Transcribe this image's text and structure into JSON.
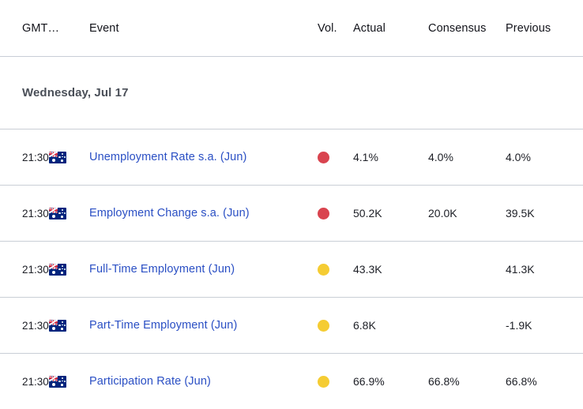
{
  "table": {
    "columns": {
      "time": "GMT…",
      "event": "Event",
      "volatility": "Vol.",
      "actual": "Actual",
      "consensus": "Consensus",
      "previous": "Previous"
    },
    "date_group": "Wednesday, Jul 17",
    "rows": [
      {
        "time": "21:30",
        "flag": "australia-flag-icon",
        "event": "Unemployment Rate s.a. (Jun)",
        "volatility": "high",
        "volatility_color": "#d9444f",
        "actual": "4.1%",
        "consensus": "4.0%",
        "previous": "4.0%"
      },
      {
        "time": "21:30",
        "flag": "australia-flag-icon",
        "event": "Employment Change s.a. (Jun)",
        "volatility": "high",
        "volatility_color": "#d9444f",
        "actual": "50.2K",
        "consensus": "20.0K",
        "previous": "39.5K"
      },
      {
        "time": "21:30",
        "flag": "australia-flag-icon",
        "event": "Full-Time Employment (Jun)",
        "volatility": "medium",
        "volatility_color": "#f5cc33",
        "actual": "43.3K",
        "consensus": "",
        "previous": "41.3K"
      },
      {
        "time": "21:30",
        "flag": "australia-flag-icon",
        "event": "Part-Time Employment (Jun)",
        "volatility": "medium",
        "volatility_color": "#f5cc33",
        "actual": "6.8K",
        "consensus": "",
        "previous": "-1.9K"
      },
      {
        "time": "21:30",
        "flag": "australia-flag-icon",
        "event": "Participation Rate (Jun)",
        "volatility": "medium",
        "volatility_color": "#f5cc33",
        "actual": "66.9%",
        "consensus": "66.8%",
        "previous": "66.8%"
      }
    ]
  },
  "colors": {
    "link": "#2a4fc4",
    "text": "#1d1f26",
    "date_text": "#4a4f58",
    "divider": "#c9ced6",
    "vol_high": "#d9444f",
    "vol_medium": "#f5cc33"
  }
}
